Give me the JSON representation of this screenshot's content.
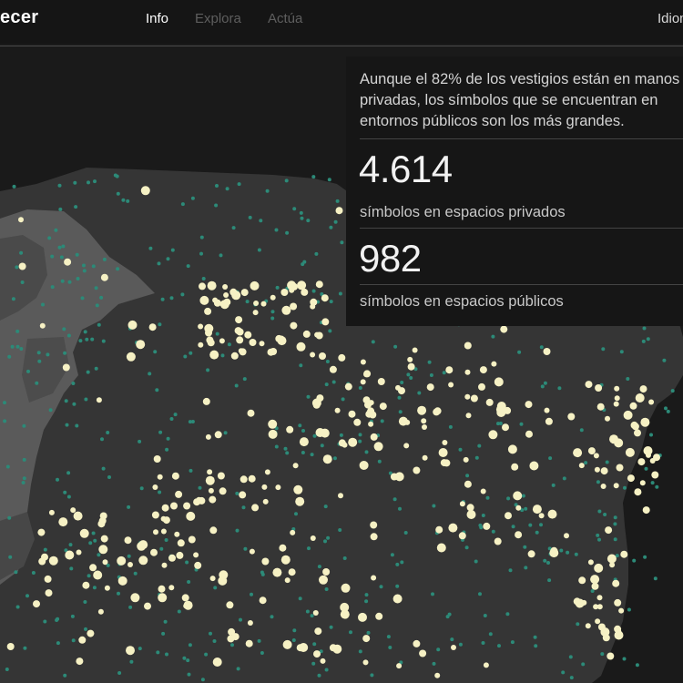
{
  "header": {
    "brand": "ecer",
    "nav": [
      {
        "label": "Info",
        "active": true
      },
      {
        "label": "Explora",
        "active": false
      },
      {
        "label": "Actúa",
        "active": false
      }
    ],
    "language_label": "Idiom"
  },
  "panel": {
    "intro": "Aunque el 82% de los vestigios están en manos privadas, los símbolos que se encuentran en entornos públicos son los más grandes.",
    "stats": [
      {
        "value": "4.614",
        "label": "símbolos en espacios privados"
      },
      {
        "value": "982",
        "label": "símbolos en espacios públicos"
      }
    ]
  },
  "map": {
    "colors": {
      "background": "#1a1a1a",
      "land": "#353535",
      "portugal": "#5a5a5a",
      "private_dot": "#2c8a78",
      "public_dot": "#f6f1c4"
    }
  }
}
